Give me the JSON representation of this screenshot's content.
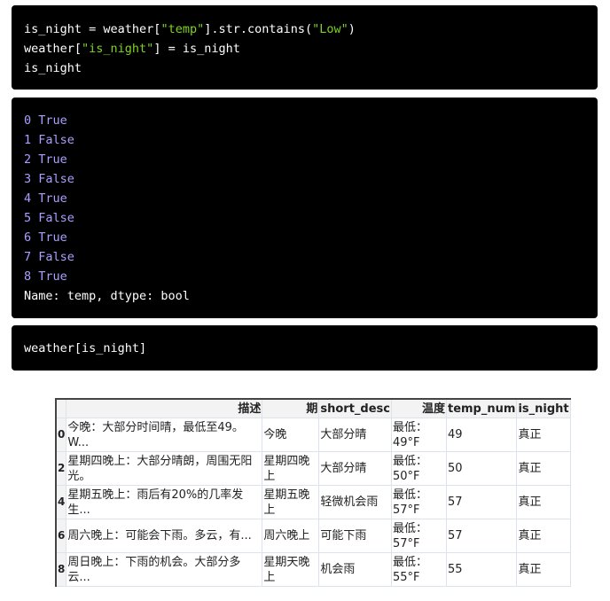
{
  "cell1": {
    "code": [
      [
        {
          "t": "is_night = weather["
        },
        {
          "t": "\"temp\"",
          "s": 1
        },
        {
          "t": "].str.contains("
        },
        {
          "t": "\"Low\"",
          "s": 1
        },
        {
          "t": ")"
        }
      ],
      [
        {
          "t": "weather["
        },
        {
          "t": "\"is_night\"",
          "s": 1
        },
        {
          "t": "] = is_night"
        }
      ],
      [
        {
          "t": "is_night"
        }
      ]
    ]
  },
  "output1": {
    "lines": [
      "0 True",
      "1 False",
      "2 True",
      "3 False",
      "4 True",
      "5 False",
      "6 True",
      "7 False",
      "8 True"
    ],
    "footer": "Name: temp, dtype: bool",
    "color": "#a9a0ff"
  },
  "cell2": {
    "code": "weather[is_night]"
  },
  "table": {
    "columns": [
      "",
      "描述",
      "期",
      "short_desc",
      "温度",
      "temp_num",
      "is_night"
    ],
    "rows": [
      {
        "index": "0",
        "desc": "今晚：大部分时间晴，最低至49。W...",
        "period": "今晚",
        "short_desc": "大部分晴",
        "temp": "最低：49°F",
        "temp_num": "49",
        "is_night": "真正"
      },
      {
        "index": "2",
        "desc": "星期四晚上：大部分晴朗，周围无阳光。",
        "period": "星期四晚上",
        "short_desc": "大部分晴",
        "temp": "最低：50°F",
        "temp_num": "50",
        "is_night": "真正"
      },
      {
        "index": "4",
        "desc": "星期五晚上：雨后有20%的几率发生...",
        "period": "星期五晚上",
        "short_desc": "轻微机会雨",
        "temp": "最低：57°F",
        "temp_num": "57",
        "is_night": "真正"
      },
      {
        "index": "6",
        "desc": "周六晚上：可能会下雨。多云，有...",
        "period": "周六晚上",
        "short_desc": "可能下雨",
        "temp": "最低：57°F",
        "temp_num": "57",
        "is_night": "真正"
      },
      {
        "index": "8",
        "desc": "周日晚上：下雨的机会。大部分多云...",
        "period": "星期天晚上",
        "short_desc": "机会雨",
        "temp": "最低：55°F",
        "temp_num": "55",
        "is_night": "真正"
      }
    ]
  }
}
